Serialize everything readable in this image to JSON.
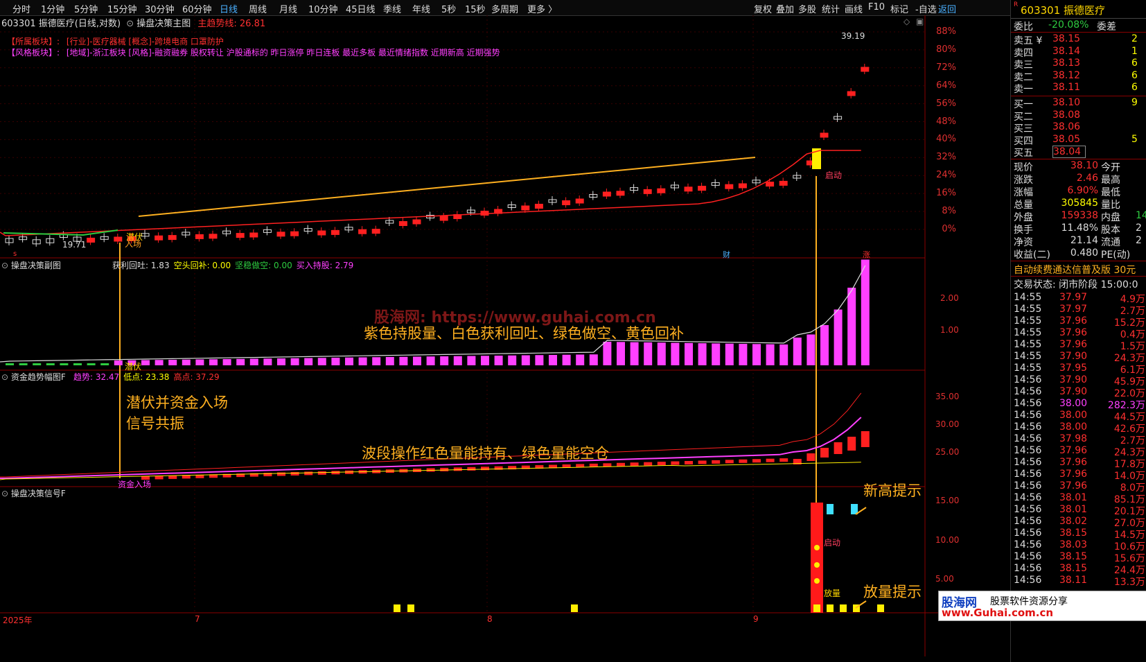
{
  "toolbar": {
    "periods": [
      "分时",
      "1分钟",
      "5分钟",
      "15分钟",
      "30分钟",
      "60分钟",
      "日线",
      "周线",
      "月线",
      "10分钟",
      "45日线",
      "季线",
      "年线",
      "5秒",
      "15秒",
      "多周期",
      "更多 〉"
    ],
    "active": "日线",
    "tools": [
      "复权",
      "叠加",
      "多股",
      "统计",
      "画线",
      "F10",
      "标记",
      "-自选",
      "返回"
    ]
  },
  "main": {
    "stock_title": "603301 振德医疗(日线,对数)",
    "indicator_name": "操盘决策主图",
    "trend_label": "主趋势线: 26.81",
    "sector_label": "【所属板块】:",
    "sector_text": "[行业]-医疗器械 [概念]-跨境电商 口罩防护",
    "style_label": "【风格板块】:",
    "style_text": "[地域]-浙江板块 [风格]-融资融券 股权转让 沪股通标的 昨日涨停 昨日连板 最近多板 最近情绪指数 近期新高 近期强势",
    "high_price": "39.19",
    "low_price": "19.71",
    "pct_ticks": [
      "88%",
      "80%",
      "72%",
      "64%",
      "56%",
      "48%",
      "40%",
      "32%",
      "24%",
      "16%",
      "8%",
      "0%"
    ],
    "signal_qianfu": "潜伏",
    "signal_ruchang": "入场",
    "signal_qidong": "启动",
    "marker_cai": "财",
    "marker_zhang": "涨",
    "marker_s": "s"
  },
  "sub1": {
    "name": "操盘决策副图",
    "values": [
      {
        "label": "获利回吐: 1.83",
        "color": "#dddddd"
      },
      {
        "label": "空头回补: 0.00",
        "color": "#ffff00"
      },
      {
        "label": "坚稳做空: 0.00",
        "color": "#2ecc40"
      },
      {
        "label": "买入持股: 2.79",
        "color": "#ff40ff"
      }
    ],
    "ticks": [
      "2.00",
      "1.00"
    ],
    "watermark": "股海网: https://www.guhai.com.cn",
    "note": "紫色持股量、白色获利回吐、绿色做空、黄色回补",
    "signal_qianfu": "潜伏"
  },
  "sub2": {
    "name": "资金趋势幅图F",
    "values": [
      {
        "label": "趋势: 32.47",
        "color": "#ff40ff"
      },
      {
        "label": "低点: 23.38",
        "color": "#ffff00"
      },
      {
        "label": "高点: 37.29",
        "color": "#ff3030"
      }
    ],
    "ticks": [
      "35.00",
      "30.00",
      "25.00"
    ],
    "note": "波段操作红色量能持有、绿色量能空仓",
    "note_left_1": "潜伏并资金入场",
    "note_left_2": "信号共振",
    "signal_zijin": "资金入场"
  },
  "sub3": {
    "name": "操盘决策信号F",
    "ticks": [
      "15.00",
      "10.00",
      "5.00"
    ],
    "signal_qidong": "启动",
    "signal_fangliang": "放量",
    "note_xingao": "新高提示",
    "note_fangliang": "放量提示"
  },
  "xaxis": {
    "labels": [
      "2025年",
      "7",
      "8",
      "9"
    ]
  },
  "quote": {
    "code_name": "603301 振德医疗",
    "weibi_label": "委比",
    "weibi_value": "-20.08%",
    "weicha_label": "委差",
    "asks": [
      {
        "label": "卖五 ¥",
        "price": "38.15",
        "vol": "2"
      },
      {
        "label": "卖四",
        "price": "38.14",
        "vol": "1"
      },
      {
        "label": "卖三",
        "price": "38.13",
        "vol": "6"
      },
      {
        "label": "卖二",
        "price": "38.12",
        "vol": "6"
      },
      {
        "label": "卖一",
        "price": "38.11",
        "vol": "6"
      }
    ],
    "bids": [
      {
        "label": "买一",
        "price": "38.10",
        "vol": "9"
      },
      {
        "label": "买二",
        "price": "38.08",
        "vol": ""
      },
      {
        "label": "买三",
        "price": "38.06",
        "vol": ""
      },
      {
        "label": "买四",
        "price": "38.05",
        "vol": "5"
      },
      {
        "label": "买五",
        "price": "38.04",
        "vol": ""
      }
    ],
    "stats": [
      {
        "l1": "现价",
        "v1": "38.10",
        "c1": "red",
        "l2": "今开"
      },
      {
        "l1": "涨跌",
        "v1": "2.46",
        "c1": "red",
        "l2": "最高"
      },
      {
        "l1": "涨幅",
        "v1": "6.90%",
        "c1": "red",
        "l2": "最低"
      },
      {
        "l1": "总量",
        "v1": "305845",
        "c1": "yellow",
        "l2": "量比"
      },
      {
        "l1": "外盘",
        "v1": "159338",
        "c1": "red",
        "l2": "内盘",
        "v2": "14",
        "c2": "green"
      },
      {
        "l1": "换手",
        "v1": "11.48%",
        "c1": "white",
        "l2": "股本",
        "v2": "2",
        "c2": "white"
      },
      {
        "l1": "净资",
        "v1": "21.14",
        "c1": "white",
        "l2": "流通",
        "v2": "2",
        "c2": "white"
      },
      {
        "l1": "收益(二)",
        "v1": "0.480",
        "c1": "white",
        "l2": "PE(动)"
      }
    ],
    "ad": "自动续费通达信普及版  30元",
    "trade_status": "交易状态: 闭市阶段 15:00:0",
    "ticks": [
      {
        "t": "14:55",
        "p": "37.97",
        "v": "4.9万",
        "c": "red"
      },
      {
        "t": "14:55",
        "p": "37.97",
        "v": "2.7万",
        "c": "red"
      },
      {
        "t": "14:55",
        "p": "37.96",
        "v": "15.2万",
        "c": "red"
      },
      {
        "t": "14:55",
        "p": "37.96",
        "v": "0.4万",
        "c": "red"
      },
      {
        "t": "14:55",
        "p": "37.96",
        "v": "1.5万",
        "c": "red"
      },
      {
        "t": "14:55",
        "p": "37.90",
        "v": "24.3万",
        "c": "red"
      },
      {
        "t": "14:55",
        "p": "37.95",
        "v": "6.1万",
        "c": "red"
      },
      {
        "t": "14:56",
        "p": "37.90",
        "v": "45.9万",
        "c": "red"
      },
      {
        "t": "14:56",
        "p": "37.90",
        "v": "22.0万",
        "c": "red"
      },
      {
        "t": "14:56",
        "p": "38.00",
        "v": "282.3万",
        "c": "magenta"
      },
      {
        "t": "14:56",
        "p": "38.00",
        "v": "44.5万",
        "c": "red"
      },
      {
        "t": "14:56",
        "p": "38.00",
        "v": "42.6万",
        "c": "red"
      },
      {
        "t": "14:56",
        "p": "37.98",
        "v": "2.7万",
        "c": "red"
      },
      {
        "t": "14:56",
        "p": "37.96",
        "v": "24.3万",
        "c": "red"
      },
      {
        "t": "14:56",
        "p": "37.96",
        "v": "17.8万",
        "c": "red"
      },
      {
        "t": "14:56",
        "p": "37.96",
        "v": "14.0万",
        "c": "red"
      },
      {
        "t": "14:56",
        "p": "37.96",
        "v": "8.0万",
        "c": "red"
      },
      {
        "t": "14:56",
        "p": "38.01",
        "v": "85.1万",
        "c": "red"
      },
      {
        "t": "14:56",
        "p": "38.01",
        "v": "20.1万",
        "c": "red"
      },
      {
        "t": "14:56",
        "p": "38.02",
        "v": "27.0万",
        "c": "red"
      },
      {
        "t": "14:56",
        "p": "38.15",
        "v": "14.5万",
        "c": "red"
      },
      {
        "t": "14:56",
        "p": "38.03",
        "v": "10.6万",
        "c": "red"
      },
      {
        "t": "14:56",
        "p": "38.15",
        "v": "15.6万",
        "c": "red"
      },
      {
        "t": "14:56",
        "p": "38.15",
        "v": "24.4万",
        "c": "red"
      },
      {
        "t": "14:56",
        "p": "38.11",
        "v": "13.3万",
        "c": "red"
      }
    ],
    "logo_main": "股海网",
    "logo_sub": "股票软件资源分享",
    "logo_url": "www.Guhai.com.cn"
  }
}
